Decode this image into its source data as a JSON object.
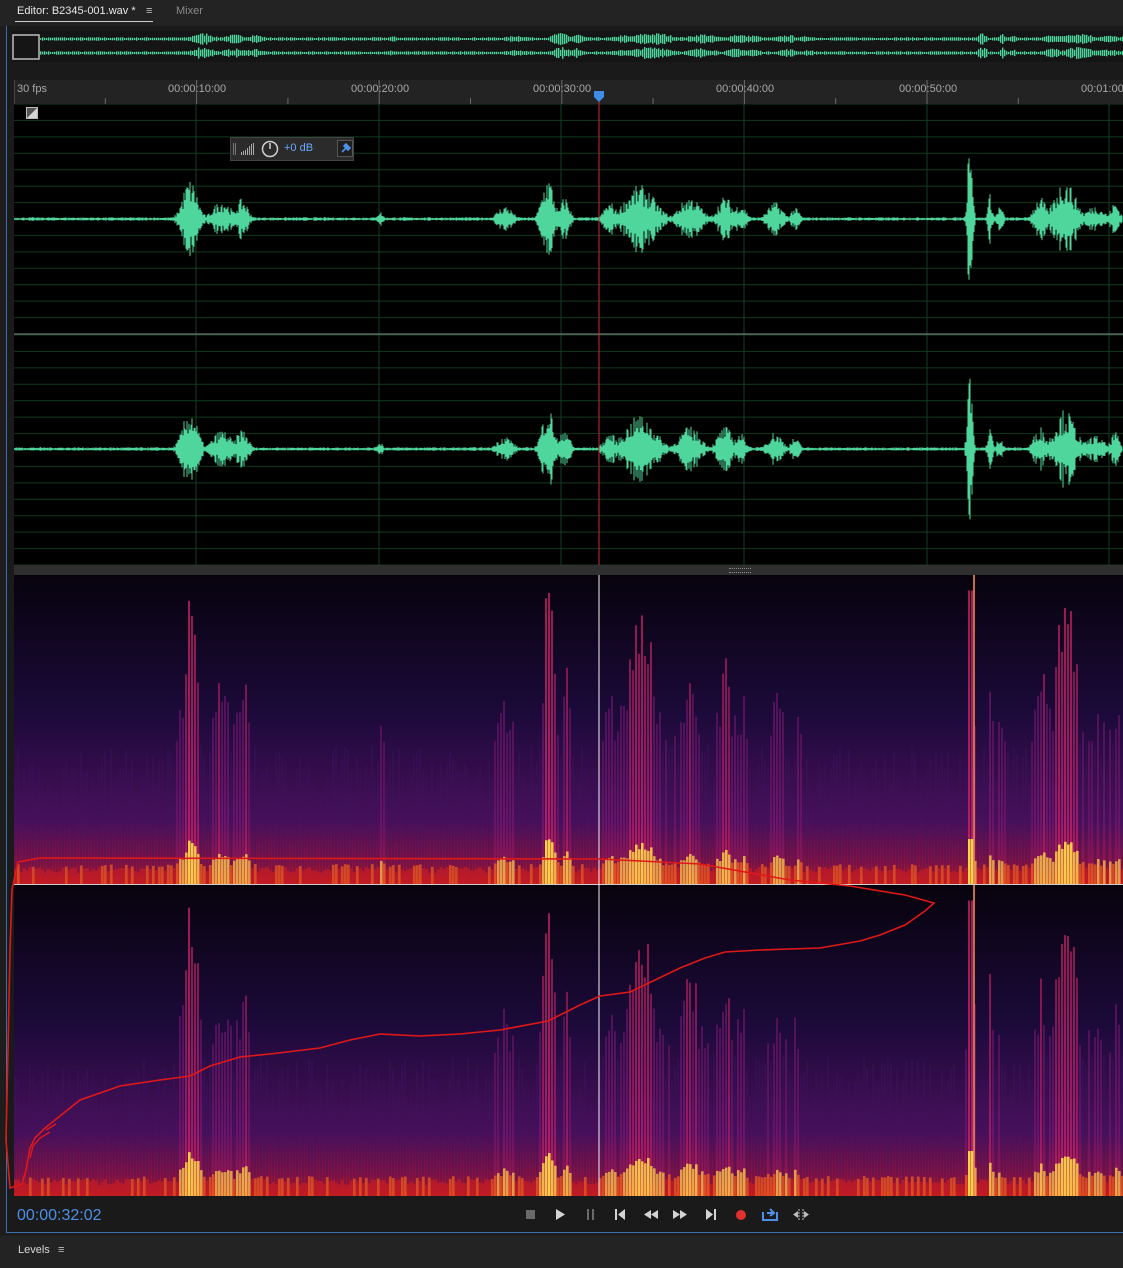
{
  "tabs": {
    "editor_label": "Editor: B2345-001.wav *",
    "menu_glyph": "≡",
    "mixer_label": "Mixer"
  },
  "ruler": {
    "fps_label": "30 fps",
    "ticks": [
      "00:00:10:00",
      "00:00:20:00",
      "00:00:30:00",
      "00:00:40:00",
      "00:00:50:00",
      "00:01:00"
    ]
  },
  "hud": {
    "gain_label": "+0 dB",
    "icons": [
      "grip-icon",
      "meter-bars-icon",
      "gain-knob-icon",
      "pin-icon"
    ]
  },
  "playhead": {
    "timecode": "00:00:32:02"
  },
  "transport": {
    "buttons": [
      "stop",
      "play",
      "pause",
      "go-to-start",
      "rewind",
      "fast-forward",
      "go-to-end",
      "record",
      "loop",
      "skip-selection"
    ]
  },
  "bottom_panel": {
    "title": "Levels",
    "menu_glyph": "≡"
  },
  "colors": {
    "waveform": "#4fd69c",
    "playhead_line": "#cc2b2b",
    "playhead_marker": "#3c8ce8",
    "timecode": "#4d90e6",
    "annotation": "#e01818",
    "record": "#e03030"
  }
}
